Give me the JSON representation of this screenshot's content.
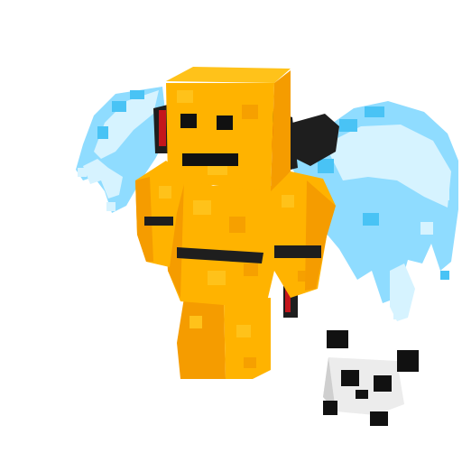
{
  "scene": {
    "subject": "voxel-character-render",
    "background_color": "#ffffff"
  },
  "character": {
    "body_color": "#ffb300",
    "body_shade_color": "#f59c00",
    "body_highlight_color": "#ffc21a",
    "face_color": "#111111",
    "headphone_color": "#1e1e1e",
    "headphone_accent_color": "#c4161c"
  },
  "wings": {
    "primary_color": "#8fdcff",
    "light_color": "#d6f3ff",
    "deep_color": "#49c3f5"
  },
  "companion": {
    "name": "panda-head",
    "fur_color": "#ececec",
    "patch_color": "#111111"
  }
}
